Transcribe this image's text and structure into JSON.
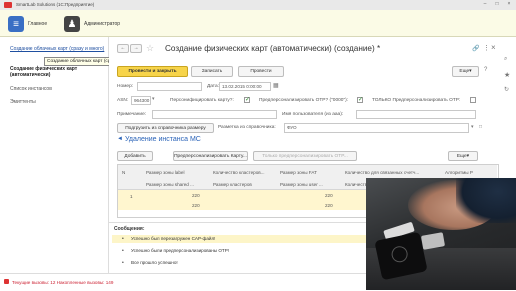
{
  "app": {
    "title": "SmartLab Solutions  (1С:Предприятие)"
  },
  "nav": {
    "home": "Главное",
    "admin": "Администратор"
  },
  "sidebar": {
    "item1": "Создание облачных карт (сразу и много)",
    "item2": "Создание физических карт (автоматически)",
    "item3": "Список инстансов",
    "item4": "Эмиттенты",
    "tooltip": "Создание облачных карт (сразу и много)"
  },
  "form": {
    "title": "Создание физических карт (автоматически) (создание) *",
    "btn_post_close": "Провести и закрыть",
    "btn_save": "Записать",
    "btn_post": "Провести",
    "btn_more": "Еще",
    "number_label": "Номер:",
    "date_label": "Дата:",
    "date_value": "13.02.2015  0:00:00",
    "asn_label": "ASN:",
    "asn_value": "964300",
    "personalize_label": "Персонифицировать карту?:",
    "prepersonalize_label": "Предперсонализировать OTP? (\"0000\"):",
    "only_prepersonalize_label": "ТОЛЬКО Предперсонализировать OTP:",
    "note_label": "Примечание:",
    "username_label": "Имя пользователя (из aaa):",
    "btn_size_ref": "Подгрузить из справочника размеру",
    "size_ref_label": "Разметка из справочника:",
    "size_ref_value": "ФУО",
    "section": "Удаление инстанса МС",
    "btn_add": "Добавить",
    "btn_prepersonalize_card": "Предперсонализировать Карту...",
    "btn_only_prepersonalize": "Только предперсонализировать OTP...",
    "btn_more2": "Еще"
  },
  "grid": {
    "headers_top": [
      "N",
      "Размер зоны label",
      "Количество кластеров...",
      "Размер зоны FAT",
      "Количество для связанных счетч...",
      "Алгоритмы P"
    ],
    "headers_bot": [
      "",
      "Размер зоны shared ...",
      "Размер кластеров",
      "Размер зоны user ...",
      "Количество для связанных счетч..."
    ],
    "row_n": "1",
    "row1": [
      "220",
      "220"
    ],
    "row2": [
      "220",
      "220"
    ]
  },
  "messages": {
    "title": "Сообщения:",
    "items": [
      "Успешно был перезагружен CAP-файл!",
      "Успешно были предперсонализированы OTP!",
      "Все прошло успешно!"
    ]
  },
  "status": {
    "text": "Текущие вызовы: 12   Накопленные вызовы: 149"
  },
  "colors": {
    "accent_yellow": "#f7d44a",
    "link_blue": "#1f4fa0",
    "section_blue": "#2a63b8"
  }
}
